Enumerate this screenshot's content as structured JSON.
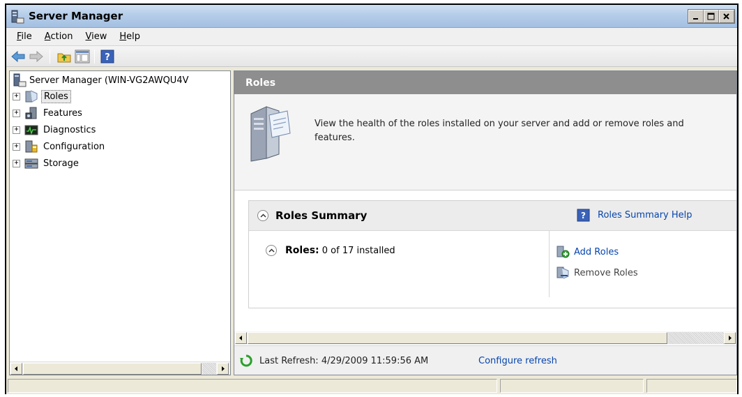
{
  "window": {
    "title": "Server Manager"
  },
  "menu": {
    "items": [
      {
        "label": "File",
        "underline": "F",
        "rest": "ile"
      },
      {
        "label": "Action",
        "underline": "A",
        "rest": "ction"
      },
      {
        "label": "View",
        "underline": "V",
        "rest": "iew"
      },
      {
        "label": "Help",
        "underline": "H",
        "rest": "elp"
      }
    ]
  },
  "toolbar": {
    "icons": [
      "back-arrow-icon",
      "forward-arrow-icon",
      "up-folder-icon",
      "show-hide-tree-icon",
      "help-icon"
    ]
  },
  "tree": {
    "root_label": "Server Manager (WIN-VG2AWQU4V",
    "nodes": [
      {
        "label": "Roles",
        "icon": "roles-icon",
        "selected": true
      },
      {
        "label": "Features",
        "icon": "features-icon",
        "selected": false
      },
      {
        "label": "Diagnostics",
        "icon": "diagnostics-icon",
        "selected": false
      },
      {
        "label": "Configuration",
        "icon": "configuration-icon",
        "selected": false
      },
      {
        "label": "Storage",
        "icon": "storage-icon",
        "selected": false
      }
    ],
    "expander_glyph": "+"
  },
  "content": {
    "header": "Roles",
    "intro_text": "View the health of the roles installed on your server and add or remove roles and features.",
    "summary": {
      "title": "Roles Summary",
      "help_link": "Roles Summary Help",
      "roles_label": "Roles:",
      "roles_count": "0 of 17 installed",
      "add_roles": "Add Roles",
      "remove_roles": "Remove Roles"
    },
    "refresh": {
      "text": "Last Refresh: 4/29/2009 11:59:56 AM",
      "configure_link": "Configure refresh"
    }
  },
  "colors": {
    "link": "#0645ad",
    "header_bg": "#8e8e8e",
    "title_bar": "#b5cde8"
  }
}
